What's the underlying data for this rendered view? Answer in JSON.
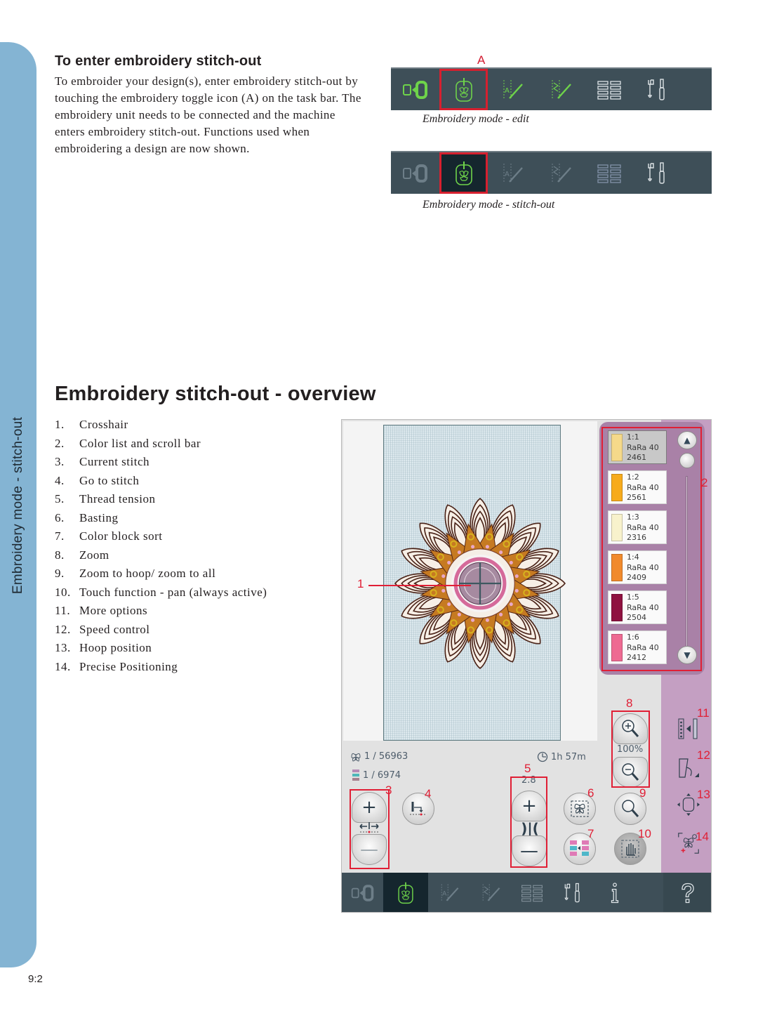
{
  "chapter_tab": {
    "label": "Embroidery mode - stitch-out"
  },
  "page_number": "9:2",
  "enter_section": {
    "heading": "To enter embroidery stitch-out",
    "paragraph": "To embroider your design(s), enter embroidery stitch-out by touching the embroidery toggle icon (A) on the task bar. The embroidery unit needs to be connected and the machine enters embroidery stitch-out. Functions used when embroidering a design are now shown.",
    "callout_A": "A",
    "taskbar_icons": [
      "sewing-mode-toggle",
      "embroidery-toggle",
      "stitch-creator",
      "sequence",
      "menu",
      "settings"
    ],
    "caption_edit": "Embroidery mode - edit",
    "caption_stitchout": "Embroidery mode - stitch-out"
  },
  "overview": {
    "heading": "Embroidery stitch-out - overview",
    "items": [
      {
        "num": "1.",
        "label": "Crosshair"
      },
      {
        "num": "2.",
        "label": "Color list and scroll bar"
      },
      {
        "num": "3.",
        "label": "Current stitch"
      },
      {
        "num": "4.",
        "label": "Go to stitch"
      },
      {
        "num": "5.",
        "label": "Thread tension"
      },
      {
        "num": "6.",
        "label": "Basting"
      },
      {
        "num": "7.",
        "label": "Color block sort"
      },
      {
        "num": "8.",
        "label": "Zoom"
      },
      {
        "num": "9.",
        "label": "Zoom to hoop/ zoom to all"
      },
      {
        "num": "10.",
        "label": "Touch function - pan (always active)"
      },
      {
        "num": "11.",
        "label": "More options"
      },
      {
        "num": "12.",
        "label": "Speed control"
      },
      {
        "num": "13.",
        "label": "Hoop position"
      },
      {
        "num": "14.",
        "label": "Precise Positioning"
      }
    ]
  },
  "screen": {
    "colors": [
      {
        "index": "1:1",
        "thread": "RaRa 40",
        "code": "2461",
        "swatch": "#f5d98a",
        "active": true
      },
      {
        "index": "1:2",
        "thread": "RaRa 40",
        "code": "2561",
        "swatch": "#f7ab1c",
        "active": false
      },
      {
        "index": "1:3",
        "thread": "RaRa 40",
        "code": "2316",
        "swatch": "#f8f2cc",
        "active": false
      },
      {
        "index": "1:4",
        "thread": "RaRa 40",
        "code": "2409",
        "swatch": "#f18a2c",
        "active": false
      },
      {
        "index": "1:5",
        "thread": "RaRa 40",
        "code": "2504",
        "swatch": "#8f1240",
        "active": false
      },
      {
        "index": "1:6",
        "thread": "RaRa 40",
        "code": "2412",
        "swatch": "#ee6a92",
        "active": false
      }
    ],
    "stitch_counter": "1 / 56963",
    "color_block_counter": "1 / 6974",
    "time_remaining": "1h 57m",
    "thread_tension_value": "2.8",
    "zoom_level": "100%",
    "callouts": [
      "1",
      "2",
      "3",
      "4",
      "5",
      "6",
      "7",
      "8",
      "9",
      "10",
      "11",
      "12",
      "13",
      "14"
    ],
    "accent_red": "#e01f35",
    "panel_purple": "#c49fc2",
    "taskbar_bg": "#3e4f58"
  }
}
